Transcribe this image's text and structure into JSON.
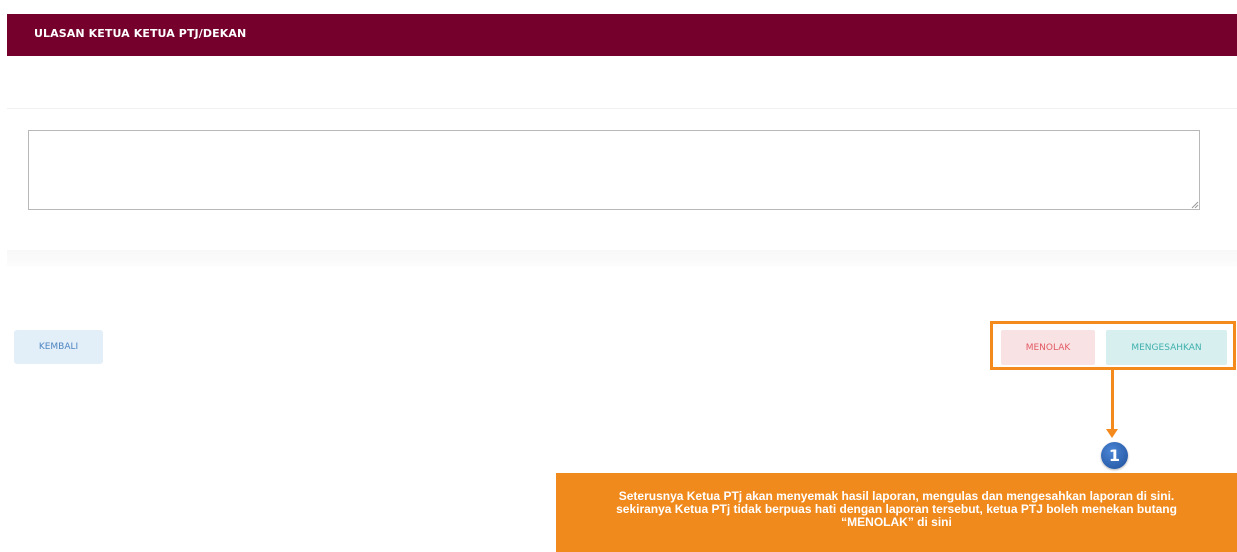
{
  "header": {
    "title": "ULASAN KETUA KETUA PTJ/DEKAN"
  },
  "comment": {
    "value": "",
    "placeholder": ""
  },
  "buttons": {
    "back": "KEMBALI",
    "reject": "MENOLAK",
    "approve": "MENGESAHKAN"
  },
  "annotation": {
    "step_number": "1",
    "lines": [
      "Seterusnya Ketua PTj akan menyemak hasil laporan, mengulas dan mengesahkan laporan di sini.",
      "sekiranya Ketua PTj tidak berpuas hati dengan laporan tersebut, ketua PTJ boleh menekan butang",
      "“MENOLAK” di sini"
    ]
  },
  "colors": {
    "header_bg": "#75002c",
    "accent_orange": "#f08a1d",
    "reject_bg": "#f9e2e3",
    "approve_bg": "#d7efef",
    "back_bg": "#e2eef8"
  }
}
